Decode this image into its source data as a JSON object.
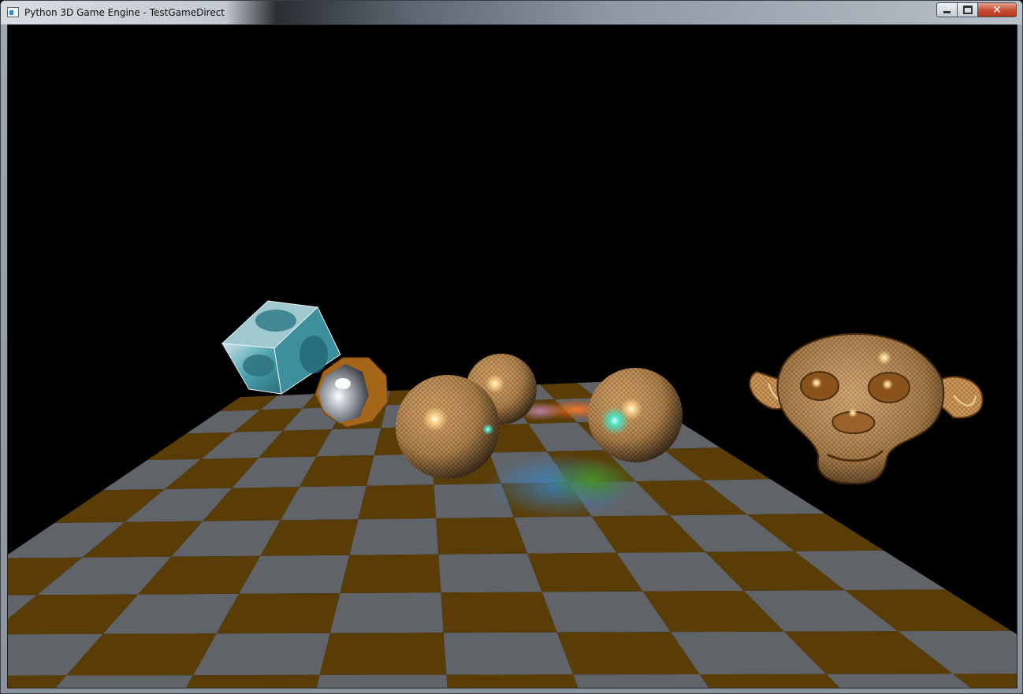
{
  "window": {
    "title": "Python 3D Game Engine - TestGameDirect",
    "icon": "window-app-icon",
    "controls": {
      "minimize": "minimize-icon",
      "maximize": "maximize-icon",
      "close": "✕"
    }
  },
  "scene": {
    "background": "#000000",
    "floor": {
      "colors": [
        "#5a3c07",
        "#606468"
      ],
      "highlight_colors": [
        "#3a86c8",
        "#3e7f12",
        "#d05a10"
      ]
    },
    "objects": [
      {
        "name": "textured-cube",
        "color": "#4aa3b0"
      },
      {
        "name": "faceted-sphere",
        "color": "#8a8f96",
        "band_color": "#a5661a"
      },
      {
        "name": "checker-sphere-small",
        "color": "#b07a3e"
      },
      {
        "name": "checker-sphere-left",
        "color": "#ad7840"
      },
      {
        "name": "checker-sphere-right",
        "color": "#ae7a42"
      },
      {
        "name": "monkey-head",
        "color": "#b07032"
      }
    ],
    "lights": [
      "#ffd890",
      "#40e8c8",
      "#ffffff"
    ]
  }
}
